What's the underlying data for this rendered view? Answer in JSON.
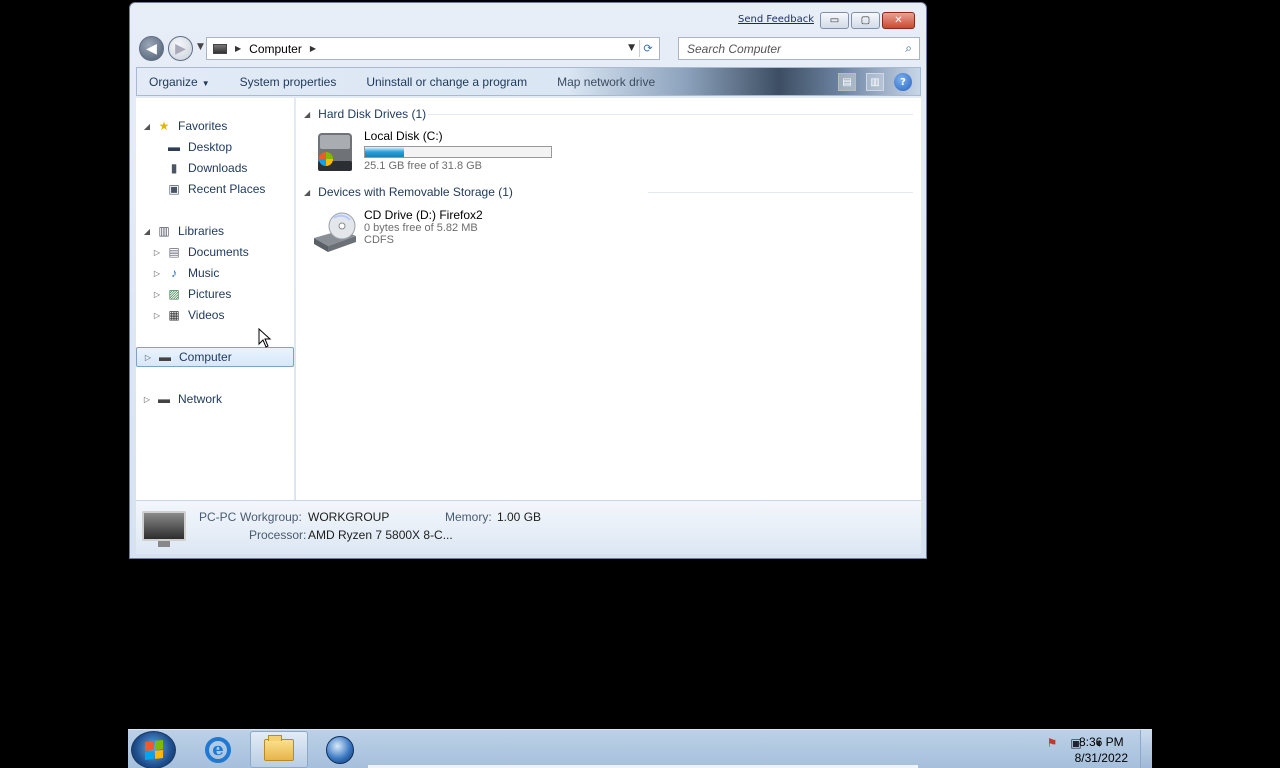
{
  "window": {
    "send_feedback": "Send Feedback",
    "minimize": "▭",
    "maximize": "▢",
    "close": "✕"
  },
  "address": {
    "crumb": "Computer",
    "search_placeholder": "Search Computer"
  },
  "commands": {
    "organize": "Organize",
    "system_properties": "System properties",
    "uninstall": "Uninstall or change a program",
    "map_network": "Map network drive",
    "help": "?"
  },
  "nav": {
    "favorites": "Favorites",
    "desktop": "Desktop",
    "downloads": "Downloads",
    "recent_places": "Recent Places",
    "libraries": "Libraries",
    "documents": "Documents",
    "music": "Music",
    "pictures": "Pictures",
    "videos": "Videos",
    "computer": "Computer",
    "network": "Network"
  },
  "content": {
    "hdd_group": "Hard Disk Drives (1)",
    "removable_group": "Devices with Removable Storage (1)",
    "local_disk": {
      "name": "Local Disk (C:)",
      "free": "25.1 GB free of 31.8 GB",
      "used_fraction": 0.21
    },
    "cd_drive": {
      "name": "CD Drive (D:) Firefox2",
      "free": "0 bytes free of 5.82 MB",
      "fs": "CDFS"
    }
  },
  "details": {
    "computer_name": "PC-PC",
    "workgroup_label": "Workgroup:",
    "workgroup_value": "WORKGROUP",
    "memory_label": "Memory:",
    "memory_value": "1.00 GB",
    "processor_label": "Processor:",
    "processor_value": "AMD Ryzen 7 5800X 8-C..."
  },
  "taskbar": {
    "time": "8:36 PM",
    "date": "8/31/2022"
  },
  "colors": {
    "accent": "#1e395b",
    "usage_fill": "#26a0da",
    "close_button": "#c74a30"
  }
}
